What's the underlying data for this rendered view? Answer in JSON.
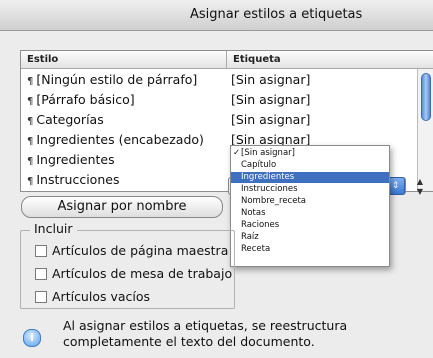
{
  "window": {
    "title": "Asignar estilos a etiquetas"
  },
  "table": {
    "headers": [
      "Estilo",
      "Etiqueta"
    ],
    "rows": [
      {
        "style": "[Ningún estilo de párrafo]",
        "tag": "[Sin asignar]"
      },
      {
        "style": "[Párrafo básico]",
        "tag": "[Sin asignar]"
      },
      {
        "style": "Categorías",
        "tag": "[Sin asignar]"
      },
      {
        "style": "Ingredientes (encabezado)",
        "tag": "[Sin asignar]"
      },
      {
        "style": "Ingredientes",
        "tag": ""
      },
      {
        "style": "Instrucciones",
        "tag": ""
      }
    ],
    "paragraph_icon": "¶"
  },
  "tag_menu": {
    "checked_item": "[Sin asignar]",
    "items": [
      "[Sin asignar]",
      "Capítulo",
      "Ingredientes",
      "Instrucciones",
      "Nombre_receta",
      "Notas",
      "Raciones",
      "Raíz",
      "Receta"
    ],
    "selected_index": 2,
    "highlight_color": "#3f6fbf"
  },
  "assign_button": {
    "label": "Asignar por nombre"
  },
  "include_group": {
    "label": "Incluir",
    "options": [
      {
        "label": "Artículos de página maestra",
        "checked": false
      },
      {
        "label": "Artículos de mesa de trabajo",
        "checked": false
      },
      {
        "label": "Artículos vacíos",
        "checked": false
      }
    ]
  },
  "info": {
    "icon": "info-icon",
    "line1": "Al asignar estilos a etiquetas, se reestructura",
    "line2": "completamente el texto del documento."
  }
}
